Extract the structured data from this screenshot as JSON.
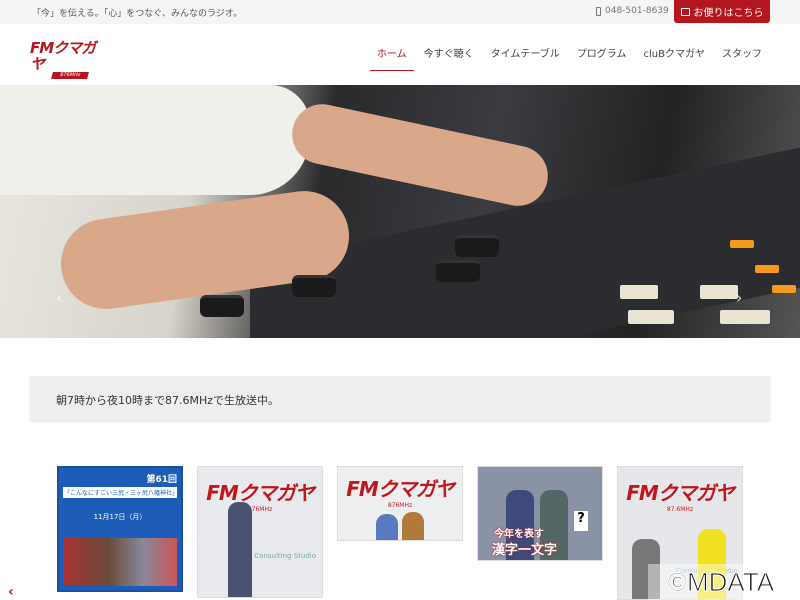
{
  "topbar": {
    "tagline": "「今」を伝える。「心」をつなぐ、みんなのラジオ。",
    "phone": "048-501-8639",
    "contact_label": "お便りはこちら"
  },
  "logo": {
    "main": "FMクマガヤ",
    "sub": "876MHz"
  },
  "nav": [
    {
      "label": "ホーム",
      "active": true
    },
    {
      "label": "今すぐ聴く"
    },
    {
      "label": "タイムテーブル"
    },
    {
      "label": "プログラム"
    },
    {
      "label": "cluBクマガヤ"
    },
    {
      "label": "スタッフ"
    }
  ],
  "hero": {
    "prev": "‹",
    "next": "›",
    "slide_count": 4,
    "active_slide": 1
  },
  "notice": {
    "text": "朝7時から夜10時まで87.6MHzで生放送中。"
  },
  "thumbs": [
    {
      "title": "第61回",
      "subtitle": "「こんなにすごい三尻・三ヶ尻八幡神社」",
      "date": "11月17日（月）"
    },
    {
      "logo": "FMクマガヤ",
      "sub": "876MHz",
      "caption": "Consulting Studio"
    },
    {
      "logo": "FMクマガヤ",
      "sub": "876MHz"
    },
    {
      "caption": "今年を表す",
      "caption2": "漢字一文字",
      "mark": "?"
    },
    {
      "logo": "FMクマガヤ",
      "sub": "87.6MHz",
      "caption": "Consulting Studio"
    }
  ],
  "carousel": {
    "prev": "‹"
  },
  "watermark": "©MDATA",
  "colors": {
    "brand": "#b3161e",
    "topbar": "#f5f5f5",
    "notice": "#eeeeee"
  }
}
